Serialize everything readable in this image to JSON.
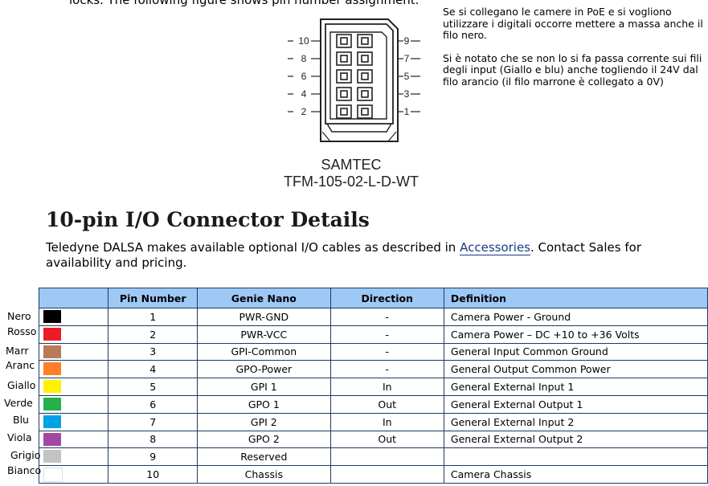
{
  "clipped_text": "locks. The following figure shows pin number assignment.",
  "note": {
    "p1": "Se si collegano le camere in PoE e si vogliono utilizzare i digitali occorre mettere a massa anche il filo nero.",
    "p2": "Si è notato che se non lo si fa passa corrente sui fili degli input (Giallo e blu) anche togliendo il 24V dal filo arancio (il filo marrone è collegato a 0V)"
  },
  "figure": {
    "left_pins": [
      "10",
      "8",
      "6",
      "4",
      "2"
    ],
    "right_pins": [
      "9",
      "7",
      "5",
      "3",
      "1"
    ],
    "brand": "SAMTEC",
    "part": "TFM-105-02-L-D-WT"
  },
  "heading": "10-pin I/O Connector Details",
  "paragraph": {
    "before": "Teledyne DALSA makes available optional I/O cables as described in",
    "link": "Accessories",
    "after": ". Contact Sales for availability and pricing."
  },
  "table": {
    "headers": [
      "Pin Number",
      "Genie Nano",
      "Direction",
      "Definition"
    ],
    "rows": [
      {
        "label": "Nero",
        "color": "#000000",
        "pin": "1",
        "genie": "PWR-GND",
        "dir": "-",
        "def": "Camera Power - Ground"
      },
      {
        "label": "Rosso",
        "color": "#ed1c24",
        "pin": "2",
        "genie": "PWR-VCC",
        "dir": "-",
        "def": "Camera Power – DC +10 to +36 Volts"
      },
      {
        "label": "Marr",
        "color": "#b97a57",
        "pin": "3",
        "genie": "GPI-Common",
        "dir": "-",
        "def": "General Input Common Ground"
      },
      {
        "label": "Aranc",
        "color": "#ff7f27",
        "pin": "4",
        "genie": "GPO-Power",
        "dir": "-",
        "def": "General Output Common Power"
      },
      {
        "label": "Giallo",
        "color": "#fff200",
        "pin": "5",
        "genie": "GPI 1",
        "dir": "In",
        "def": "General External Input 1"
      },
      {
        "label": "Verde",
        "color": "#22b14c",
        "pin": "6",
        "genie": "GPO 1",
        "dir": "Out",
        "def": "General External Output 1"
      },
      {
        "label": "Blu",
        "color": "#00a2e8",
        "pin": "7",
        "genie": "GPI 2",
        "dir": "In",
        "def": "General External Input 2"
      },
      {
        "label": "Viola",
        "color": "#a349a4",
        "pin": "8",
        "genie": "GPO 2",
        "dir": "Out",
        "def": "General External Output 2"
      },
      {
        "label": "Grigio",
        "color": "#c3c3c3",
        "pin": "9",
        "genie": "Reserved",
        "dir": "",
        "def": ""
      },
      {
        "label": "Bianco",
        "color": "#ffffff",
        "pin": "10",
        "genie": "Chassis",
        "dir": "",
        "def": "Camera Chassis"
      }
    ]
  }
}
